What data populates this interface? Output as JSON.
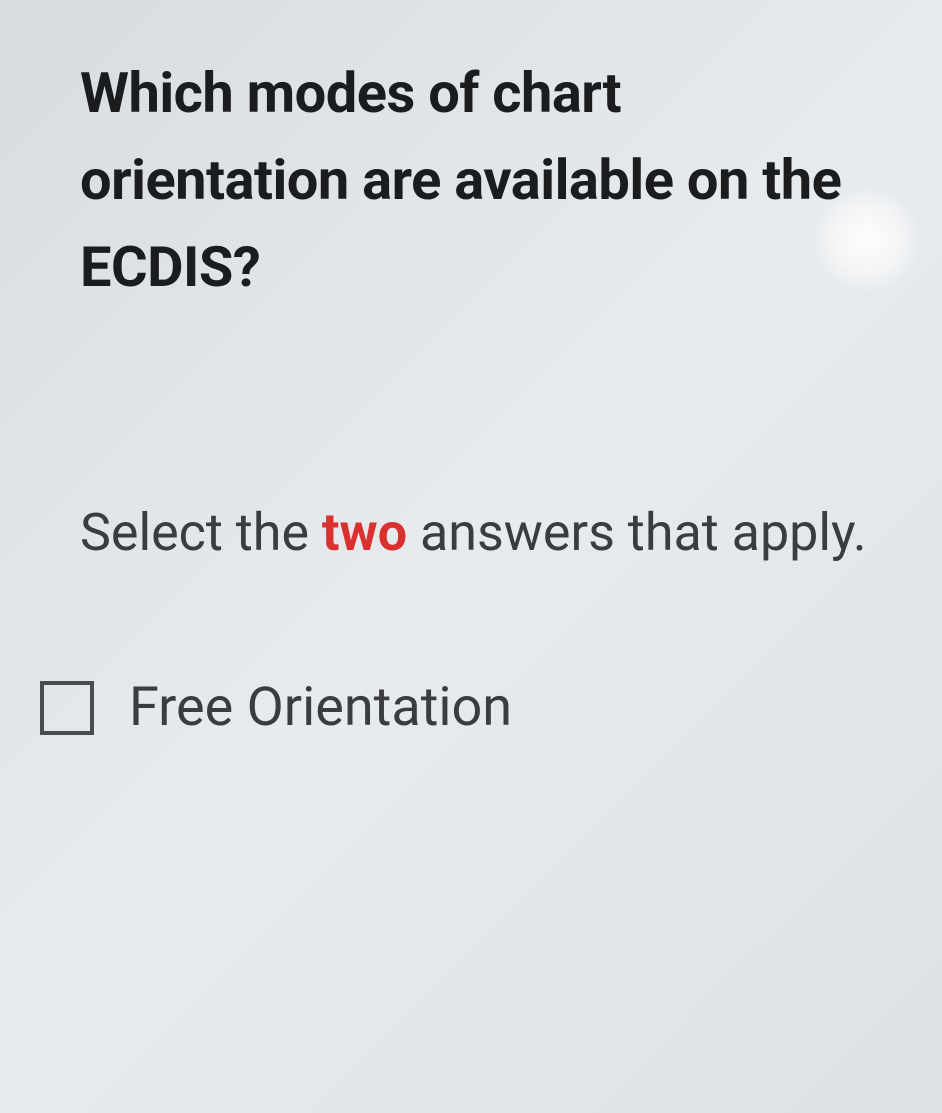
{
  "question": {
    "text": "Which modes of chart orientation are available on the ECDIS?"
  },
  "instruction": {
    "prefix": "Select the ",
    "highlight": "two",
    "suffix": " answers that apply."
  },
  "options": [
    {
      "label": "Free Orientation",
      "checked": false
    }
  ]
}
